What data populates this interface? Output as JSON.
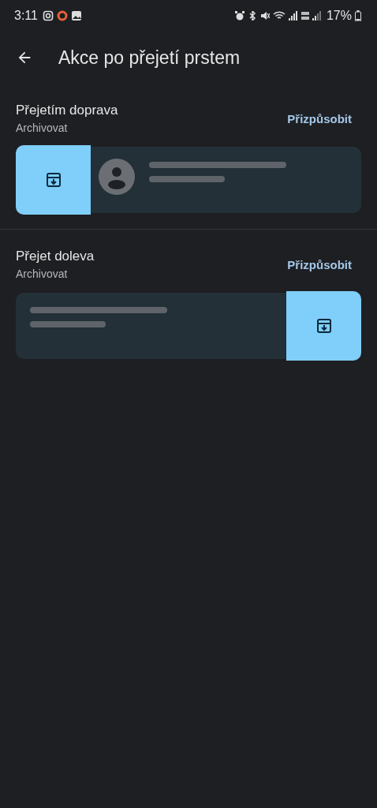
{
  "status_bar": {
    "time": "3:11",
    "battery": "17%"
  },
  "toolbar": {
    "title": "Akce po přejetí prstem"
  },
  "sections": [
    {
      "title": "Přejetím doprava",
      "action": "Archivovat",
      "button": "Přizpůsobit",
      "kind": "right"
    },
    {
      "title": "Přejet doleva",
      "action": "Archivovat",
      "button": "Přizpůsobit",
      "kind": "left"
    }
  ]
}
